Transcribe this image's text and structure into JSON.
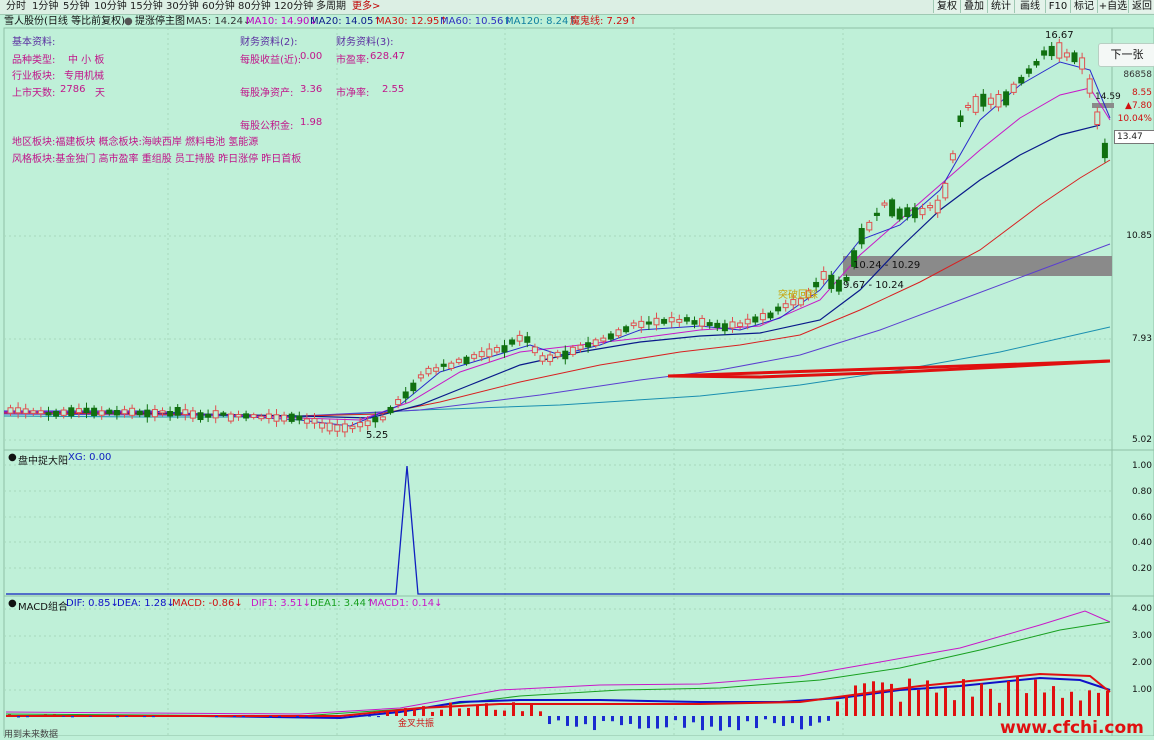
{
  "periods": [
    "分时",
    "1分钟",
    "5分钟",
    "10分钟",
    "15分钟",
    "30分钟",
    "60分钟",
    "80分钟",
    "120分钟",
    "多周期",
    "更多>"
  ],
  "right_buttons": [
    "复权",
    "叠加",
    "统计",
    "画线",
    "F10",
    "标记",
    "+自选",
    "返回"
  ],
  "stock_title": "雪人股份(日线 等比前复权)",
  "indicator_name": "提涨停主图",
  "ma": {
    "ma5": "MA5: 14.24↓",
    "ma10": "MA10: 14.90↓",
    "ma20": "MA20: 14.05↑",
    "ma30": "MA30: 12.95↑",
    "ma60": "MA60: 10.56↑",
    "ma120": "MA120: 8.24↑",
    "demon": "魔鬼线: 7.29↑"
  },
  "info": {
    "basic_title": "基本资料:",
    "fin2_title": "财务资料(2):",
    "fin3_title": "财务资料(3):",
    "type_label": "品种类型:",
    "type_value": "中 小 板",
    "industry_label": "行业板块:",
    "industry_value": "专用机械",
    "days_label": "上市天数:",
    "days_value": "2786",
    "days_unit": "天",
    "eps_label": "每股收益(近):",
    "eps_value": "0.00",
    "pe_label": "市盈率:",
    "pe_value": "628.47",
    "bvps_label": "每股净资产:",
    "bvps_value": "3.36",
    "pb_label": "市净率:",
    "pb_value": "2.55",
    "reserve_label": "每股公积金:",
    "reserve_value": "1.98",
    "region_line": "地区板块:福建板块    概念板块:海峡西岸 燃料电池 氢能源",
    "style_line": "风格板块:基金独门 高市盈率 重组股 员工持股 昨日涨停 昨日首板"
  },
  "side": {
    "next_button": "下一张",
    "code_partial": "86858",
    "price_change": "8.55",
    "arrow_change": "▲7.80",
    "pct_change": "10.04%",
    "label_up": "14.59",
    "current_price": "13.47"
  },
  "price_axis": [
    "10.85",
    "7.93",
    "5.02"
  ],
  "annotations": {
    "high": "16.67",
    "low": "5.25",
    "zone1": "10.24 - 10.29",
    "zone2": "9.67 - 10.24",
    "breakout": "突破回踩"
  },
  "pane2": {
    "title": "盘中捉大阳",
    "xg": "XG: 0.00",
    "ticks": [
      "1.00",
      "0.80",
      "0.60",
      "0.40",
      "0.20"
    ]
  },
  "pane3": {
    "title": "MACD组合",
    "dif": "DIF: 0.85↓",
    "dea": "DEA: 1.28↓",
    "macd": "MACD: -0.86↓",
    "dif1": "DIF1: 3.51↓",
    "dea1": "DEA1: 3.44↑",
    "macd1": "MACD1: 0.14↓",
    "ticks": [
      "4.00",
      "3.00",
      "2.00",
      "1.00"
    ],
    "golden_cross": "金叉共振"
  },
  "footer": {
    "left": "用到未来数据",
    "watermark": "www.cfchi.com"
  }
}
